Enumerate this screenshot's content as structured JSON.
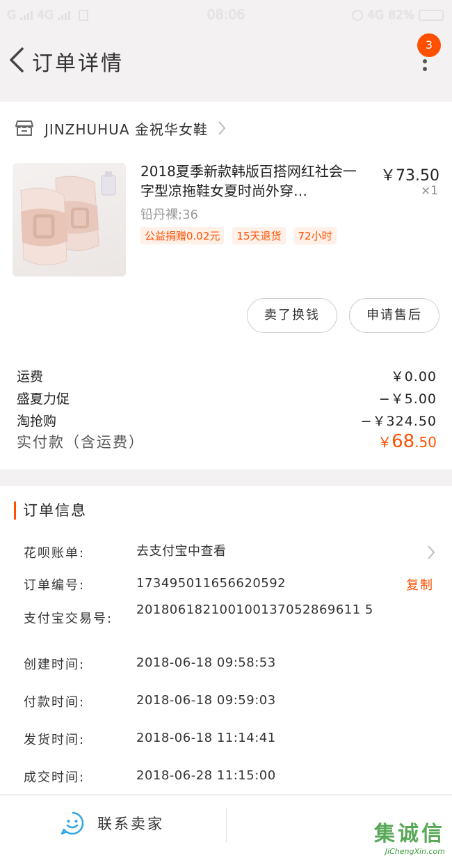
{
  "status_bar": {
    "carrier_left": "G",
    "network1": "4G",
    "time": "08:06",
    "network2": "4G",
    "battery": "82%"
  },
  "header": {
    "title": "订单详情",
    "more_badge": "3"
  },
  "order": {
    "shop_name": "JINZHUHUA 金祝华女鞋",
    "product_title": "2018夏季新款韩版百搭网红社会一字型凉拖鞋女夏时尚外穿…",
    "price": "￥73.50",
    "quantity": "×1",
    "sku": "铅丹裸;36",
    "tags": [
      "公益捐赠0.02元",
      "15天退货",
      "72小时"
    ],
    "buttons": {
      "sell": "卖了换钱",
      "after_sale": "申请售后"
    }
  },
  "fees": [
    {
      "label": "运费",
      "value": "￥0.00"
    },
    {
      "label": "盛夏力促",
      "value": "−￥5.00"
    },
    {
      "label": "淘抢购",
      "value": "−￥324.50"
    }
  ],
  "paid": {
    "label": "实付款（含运费）",
    "currency": "￥",
    "integer": "68",
    "decimal": ".50"
  },
  "order_info": {
    "title": "订单信息",
    "rows": [
      {
        "key": "花呗账单:",
        "value": "去支付宝中查看"
      },
      {
        "key": "订单编号:",
        "value": "173495011656620592",
        "action": "复制"
      },
      {
        "key": "支付宝交易号:",
        "value": "201806182100100137052869611 5"
      },
      {
        "key": "创建时间:",
        "value": "2018-06-18 09:58:53"
      },
      {
        "key": "付款时间:",
        "value": "2018-06-18 09:59:03"
      },
      {
        "key": "发货时间:",
        "value": "2018-06-18 11:14:41"
      },
      {
        "key": "成交时间:",
        "value": "2018-06-28 11:15:00"
      }
    ]
  },
  "bottom": {
    "contact_label": "联系卖家",
    "watermark": "集诚信",
    "watermark_url": "JiChengXin.com"
  },
  "colors": {
    "accent": "#ff5000",
    "background": "#f3f1f2"
  }
}
